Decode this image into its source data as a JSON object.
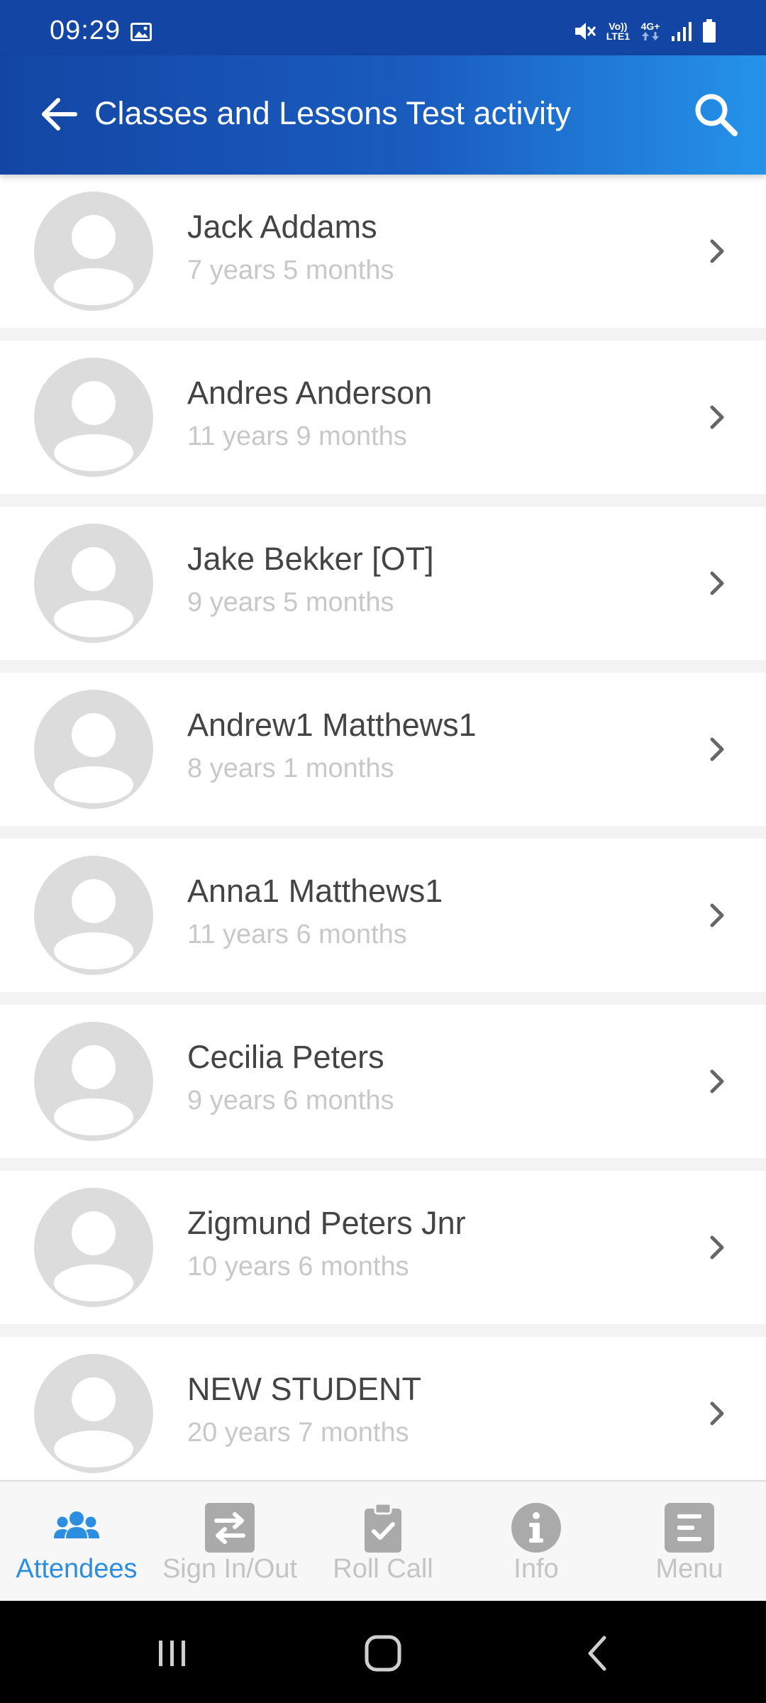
{
  "status_bar": {
    "time": "09:29",
    "volte_label": "Vo))",
    "lte_label": "LTE1",
    "network_label": "4G+"
  },
  "app_bar": {
    "title": "Classes and Lessons Test activity",
    "back_icon": "arrow-left-icon",
    "search_icon": "search-icon"
  },
  "students": [
    {
      "name": "Jack Addams",
      "age": "7 years 5 months"
    },
    {
      "name": "Andres Anderson",
      "age": "11 years 9 months"
    },
    {
      "name": "Jake Bekker [OT]",
      "age": "9 years 5 months"
    },
    {
      "name": "Andrew1 Matthews1",
      "age": "8 years 1 months"
    },
    {
      "name": "Anna1 Matthews1",
      "age": "11 years 6 months"
    },
    {
      "name": "Cecilia Peters",
      "age": "9 years 6 months"
    },
    {
      "name": "Zigmund Peters Jnr",
      "age": "10 years 6 months"
    },
    {
      "name": "NEW STUDENT",
      "age": "20 years 7 months"
    }
  ],
  "bottom_nav": {
    "items": [
      {
        "label": "Attendees",
        "icon": "users-icon",
        "active": true
      },
      {
        "label": "Sign In/Out",
        "icon": "swap-arrows-icon",
        "active": false
      },
      {
        "label": "Roll Call",
        "icon": "clipboard-check-icon",
        "active": false
      },
      {
        "label": "Info",
        "icon": "info-icon",
        "active": false
      },
      {
        "label": "Menu",
        "icon": "menu-icon",
        "active": false
      }
    ]
  },
  "colors": {
    "app_bar_start": "#1346a4",
    "app_bar_end": "#2593ea",
    "active_nav": "#2b8ee0",
    "inactive_nav": "#c4c4c4",
    "avatar_bg": "#dcdcdc"
  }
}
